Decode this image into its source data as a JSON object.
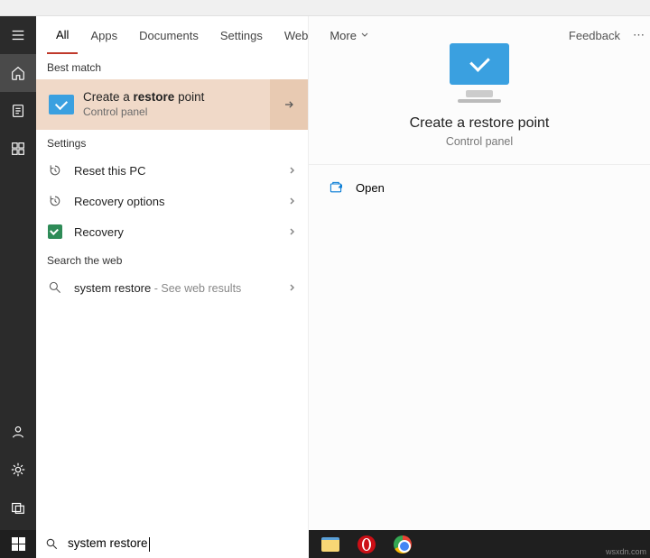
{
  "tabs": {
    "all": "All",
    "apps": "Apps",
    "documents": "Documents",
    "settings": "Settings",
    "web": "Web",
    "more": "More",
    "feedback": "Feedback"
  },
  "sections": {
    "best_match": "Best match",
    "settings": "Settings",
    "search_web": "Search the web"
  },
  "best_match": {
    "title_pre": "Create a ",
    "title_bold": "restore",
    "title_post": " point",
    "subtitle": "Control panel"
  },
  "settings_items": [
    {
      "label": "Reset this PC"
    },
    {
      "label": "Recovery options"
    },
    {
      "label": "Recovery"
    }
  ],
  "web_item": {
    "query": "system restore",
    "suffix": " - See web results"
  },
  "preview": {
    "title": "Create a restore point",
    "subtitle": "Control panel"
  },
  "actions": {
    "open": "Open"
  },
  "search": {
    "value": "system restore"
  },
  "watermark": "wsxdn.com"
}
